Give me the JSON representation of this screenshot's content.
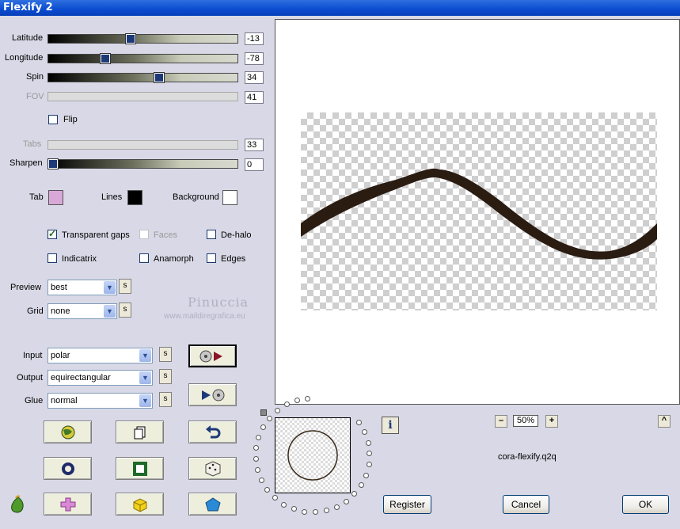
{
  "window": {
    "title": "Flexify 2"
  },
  "sliders": [
    {
      "label": "Latitude",
      "value": "-13",
      "level": 0.43,
      "enabled": true
    },
    {
      "label": "Longitude",
      "value": "-78",
      "level": 0.29,
      "enabled": true
    },
    {
      "label": "Spin",
      "value": "34",
      "level": 0.59,
      "enabled": true
    },
    {
      "label": "FOV",
      "value": "41",
      "enabled": false
    },
    {
      "label": "Tabs",
      "value": "33",
      "enabled": false
    },
    {
      "label": "Sharpen",
      "value": "0",
      "level": 0.0,
      "enabled": true
    }
  ],
  "flip": {
    "label": "Flip",
    "checked": false
  },
  "colors": {
    "tab": {
      "label": "Tab",
      "color": "#d9a8d8"
    },
    "lines": {
      "label": "Lines",
      "color": "#000000"
    },
    "background": {
      "label": "Background",
      "color": "#ffffff"
    }
  },
  "options": {
    "transparent_gaps": {
      "label": "Transparent gaps",
      "checked": true
    },
    "faces": {
      "label": "Faces",
      "checked": false,
      "enabled": false
    },
    "de_halo": {
      "label": "De-halo",
      "checked": false
    },
    "indicatrix": {
      "label": "Indicatrix",
      "checked": false
    },
    "anamorph": {
      "label": "Anamorph",
      "checked": false
    },
    "edges": {
      "label": "Edges",
      "checked": false
    }
  },
  "preview_select": {
    "label": "Preview",
    "value": "best"
  },
  "grid_select": {
    "label": "Grid",
    "value": "none"
  },
  "input_select": {
    "label": "Input",
    "value": "polar"
  },
  "output_select": {
    "label": "Output",
    "value": "equirectangular"
  },
  "glue_select": {
    "label": "Glue",
    "value": "normal"
  },
  "s_button": "s",
  "watermark": {
    "name": "Pinuccia",
    "url": "www.maildiregrafica.eu"
  },
  "zoom": {
    "value": "50%",
    "minus": "–",
    "plus": "+"
  },
  "filename": "cora-flexify.q2q",
  "info_button": "i",
  "up_button": "^",
  "buttons": {
    "register": "Register",
    "cancel": "Cancel",
    "ok": "OK"
  },
  "accent_colors": {
    "ribbon": "#2b1c12",
    "thumb": "#1d3a78"
  }
}
